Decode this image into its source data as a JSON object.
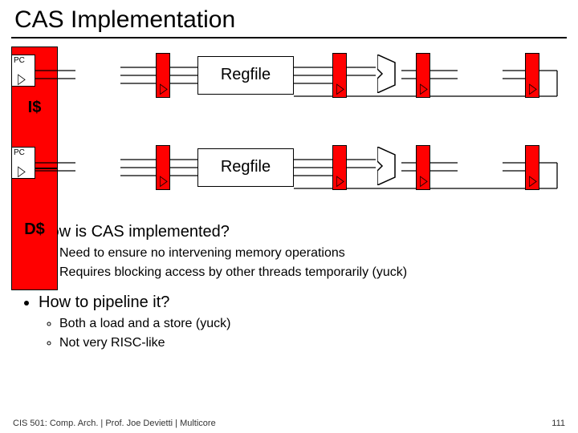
{
  "title": "CAS Implementation",
  "diagram": {
    "pc_label": "PC",
    "regfile_label": "Regfile",
    "icache_label": "I$",
    "dcache_label": "D$"
  },
  "bullets": {
    "q1": "How is CAS implemented?",
    "q1_sub1": "Need to ensure no intervening memory operations",
    "q1_sub2": "Requires blocking access by other threads temporarily (yuck)",
    "q2": "How to pipeline it?",
    "q2_sub1": "Both a load and a store (yuck)",
    "q2_sub2": "Not very RISC-like"
  },
  "footer": "CIS 501: Comp. Arch.  |  Prof. Joe Devietti  |  Multicore",
  "page_number": "111"
}
